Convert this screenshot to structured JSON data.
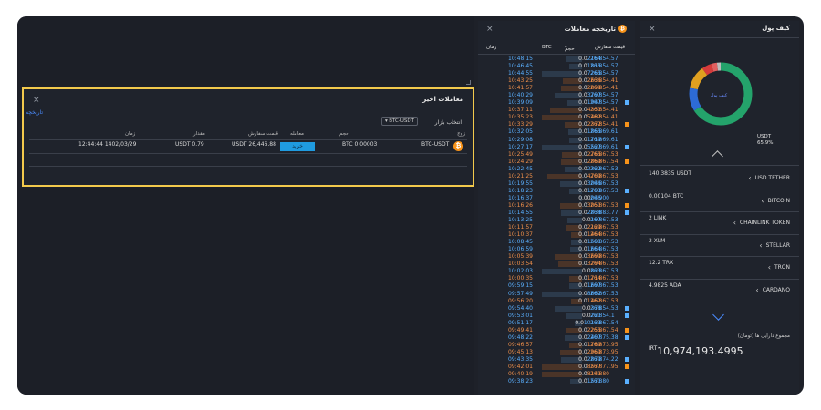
{
  "recent_trades": {
    "title": "معاملات اخیر",
    "history_link": "تاریخچه",
    "market_label": "انتخاب بازار",
    "market_value": "BTC-USDT",
    "columns": [
      "زوج",
      "حجم",
      "معامله",
      "قیمت سفارش",
      "مقدار",
      "زمان"
    ],
    "row": {
      "pair": "BTC-USDT",
      "volume": "BTC 0.00003",
      "side": "خرید",
      "order_price": "USDT 26,446.88",
      "amount": "USDT 0.79",
      "time": "12:44:44 1402/03/29"
    },
    "colors": {
      "highlight": "#f2c94c",
      "buy": "#1f9be0"
    }
  },
  "trade_history": {
    "title": "تاریخچه معاملات",
    "columns": {
      "time": "زمان",
      "volume": "حجم",
      "unit": "BTC",
      "price": "قیمت سفارش"
    },
    "rows": [
      {
        "t": "10:48:15",
        "z": "0.0",
        "v": "2164",
        "p": "26,854.57",
        "s": "buy"
      },
      {
        "t": "10:46:45",
        "z": "0.0",
        "v": "1815",
        "p": "26,854.57",
        "s": "buy"
      },
      {
        "t": "10:44:55",
        "z": "0.0",
        "v": "7265",
        "p": "26,854.57",
        "s": "buy"
      },
      {
        "t": "10:43:25",
        "z": "0.0",
        "v": "2636",
        "p": "26,854.41",
        "s": "sell"
      },
      {
        "t": "10:41:57",
        "z": "0.0",
        "v": "2899",
        "p": "26,854.41",
        "s": "sell"
      },
      {
        "t": "10:40:29",
        "z": "0.0",
        "v": "3797",
        "p": "26,854.57",
        "s": "buy"
      },
      {
        "t": "10:39:09",
        "z": "0.0",
        "v": "1947",
        "p": "26,854.57",
        "s": "buy",
        "m": true
      },
      {
        "t": "10:37:11",
        "z": "0.0",
        "v": "4351",
        "p": "26,854.41",
        "s": "sell"
      },
      {
        "t": "10:35:23",
        "z": "0.0",
        "v": "5482",
        "p": "26,854.41",
        "s": "sell"
      },
      {
        "t": "10:33:29",
        "z": "0.0",
        "v": "2372",
        "p": "26,854.41",
        "s": "sell",
        "m": true
      },
      {
        "t": "10:32:05",
        "z": "0.0",
        "v": "1865",
        "p": "26,869.61",
        "s": "buy"
      },
      {
        "t": "10:29:08",
        "z": "0.0",
        "v": "1719",
        "p": "26,869.61",
        "s": "buy"
      },
      {
        "t": "10:27:17",
        "z": "0.0",
        "v": "5527",
        "p": "26,869.61",
        "s": "buy",
        "m": true
      },
      {
        "t": "10:25:49",
        "z": "0.0",
        "v": "2765",
        "p": "26,867.53",
        "s": "sell"
      },
      {
        "t": "10:24:29",
        "z": "0.0",
        "v": "2869",
        "p": "26,867.54",
        "s": "sell",
        "m": true
      },
      {
        "t": "10:22:45",
        "z": "0.0",
        "v": "2322",
        "p": "26,867.53",
        "s": "buy"
      },
      {
        "t": "10:21:25",
        "z": "0.0",
        "v": "4709",
        "p": "26,867.53",
        "s": "sell"
      },
      {
        "t": "10:19:55",
        "z": "0.0",
        "v": "3046",
        "p": "26,867.53",
        "s": "buy"
      },
      {
        "t": "10:18:23",
        "z": "0.0",
        "v": "1703",
        "p": "26,867.53",
        "s": "buy",
        "m": true
      },
      {
        "t": "10:16:37",
        "z": "0.00",
        "v": "046",
        "p": "26,900",
        "s": "buy"
      },
      {
        "t": "10:16:26",
        "z": "0.0",
        "v": "3051",
        "p": "26,867.53",
        "s": "sell",
        "m": true
      },
      {
        "t": "10:14:55",
        "z": "0.0",
        "v": "2838",
        "p": "26,883.77",
        "s": "buy",
        "m": true
      },
      {
        "t": "10:13:25",
        "z": "0.0",
        "v": "197",
        "p": "26,867.53",
        "s": "buy"
      },
      {
        "t": "10:11:57",
        "z": "0.0",
        "v": "2129",
        "p": "26,867.53",
        "s": "sell"
      },
      {
        "t": "10:10:37",
        "z": "0.0",
        "v": "1464",
        "p": "26,867.53",
        "s": "sell"
      },
      {
        "t": "10:08:45",
        "z": "0.0",
        "v": "1501",
        "p": "26,867.53",
        "s": "buy"
      },
      {
        "t": "10:06:59",
        "z": "0.0",
        "v": "1664",
        "p": "26,867.53",
        "s": "buy"
      },
      {
        "t": "10:05:39",
        "z": "0.0",
        "v": "3699",
        "p": "26,867.53",
        "s": "sell"
      },
      {
        "t": "10:03:54",
        "z": "0.0",
        "v": "3294",
        "p": "26,867.53",
        "s": "sell"
      },
      {
        "t": "10:02:03",
        "z": "0.0",
        "v": "823",
        "p": "26,867.53",
        "s": "buy"
      },
      {
        "t": "10:00:35",
        "z": "0.0",
        "v": "1714",
        "p": "26,867.53",
        "s": "sell"
      },
      {
        "t": "09:59:15",
        "z": "0.0",
        "v": "1697",
        "p": "26,867.53",
        "s": "buy"
      },
      {
        "t": "09:57:49",
        "z": "0.0",
        "v": "8662",
        "p": "26,867.53",
        "s": "buy"
      },
      {
        "t": "09:56:20",
        "z": "0.0",
        "v": "1462",
        "p": "26,867.53",
        "s": "sell"
      },
      {
        "t": "09:54:40",
        "z": "0.0",
        "v": "378",
        "p": "26,854.53",
        "s": "buy",
        "m": true
      },
      {
        "t": "09:53:01",
        "z": "0.0",
        "v": "221",
        "p": "26,854.1",
        "s": "buy",
        "m": true
      },
      {
        "t": "09:51:17",
        "z": "0.0",
        "v": "10133",
        "p": "26,867.54",
        "s": "buy"
      },
      {
        "t": "09:49:41",
        "z": "0.0",
        "v": "2255",
        "p": "26,867.54",
        "s": "sell",
        "m": true
      },
      {
        "t": "09:48:22",
        "z": "0.0",
        "v": "2407",
        "p": "26,875.38",
        "s": "buy",
        "m": true
      },
      {
        "t": "09:46:57",
        "z": "0.0",
        "v": "1789",
        "p": "26,873.95",
        "s": "sell"
      },
      {
        "t": "09:45:13",
        "z": "0.0",
        "v": "2969",
        "p": "26,873.95",
        "s": "sell"
      },
      {
        "t": "09:43:35",
        "z": "0.0",
        "v": "2879",
        "p": "26,874.22",
        "s": "buy",
        "m": true
      },
      {
        "t": "09:42:01",
        "z": "0.0",
        "v": "8577",
        "p": "26,877.95",
        "s": "sell",
        "m": true
      },
      {
        "t": "09:40:19",
        "z": "0.0",
        "v": "8141",
        "p": "26,880",
        "s": "sell"
      },
      {
        "t": "09:38:23",
        "z": "0.0",
        "v": "1571",
        "p": "26,880",
        "s": "buy",
        "m": true
      }
    ]
  },
  "wallet": {
    "title": "کیف پول",
    "donut_center": "کیف پول",
    "donut": {
      "segments": [
        {
          "name": "USDT",
          "fraction": 0.659,
          "color": "#24a36b"
        },
        {
          "name": "BITCOIN",
          "fraction": 0.12,
          "color": "#2d6bd6"
        },
        {
          "name": "CHAINLINK TOKEN",
          "fraction": 0.12,
          "color": "#e0a020"
        },
        {
          "name": "STELLAR",
          "fraction": 0.05,
          "color": "#d63b3b"
        },
        {
          "name": "TRON",
          "fraction": 0.03,
          "color": "#e06060"
        },
        {
          "name": "CARDANO",
          "fraction": 0.021,
          "color": "#bbbbbb"
        }
      ]
    },
    "usdt_label": "USDT",
    "usdt_pct": "65.9%",
    "assets": [
      {
        "amount": "140.3835 USDT",
        "name": "USD TETHER"
      },
      {
        "amount": "0.00104 BTC",
        "name": "BITCOIN"
      },
      {
        "amount": "2 LINK",
        "name": "CHAINLINK TOKEN"
      },
      {
        "amount": "2 XLM",
        "name": "STELLAR"
      },
      {
        "amount": "12.2 TRX",
        "name": "TRON"
      },
      {
        "amount": "4.9825 ADA",
        "name": "CARDANO"
      }
    ],
    "total_label": "مجموع دارایی ها (تومان)",
    "total_currency": "IRT",
    "total_value": "10,974,193.4995"
  },
  "icons": {
    "close": "×",
    "btc": "₿"
  }
}
